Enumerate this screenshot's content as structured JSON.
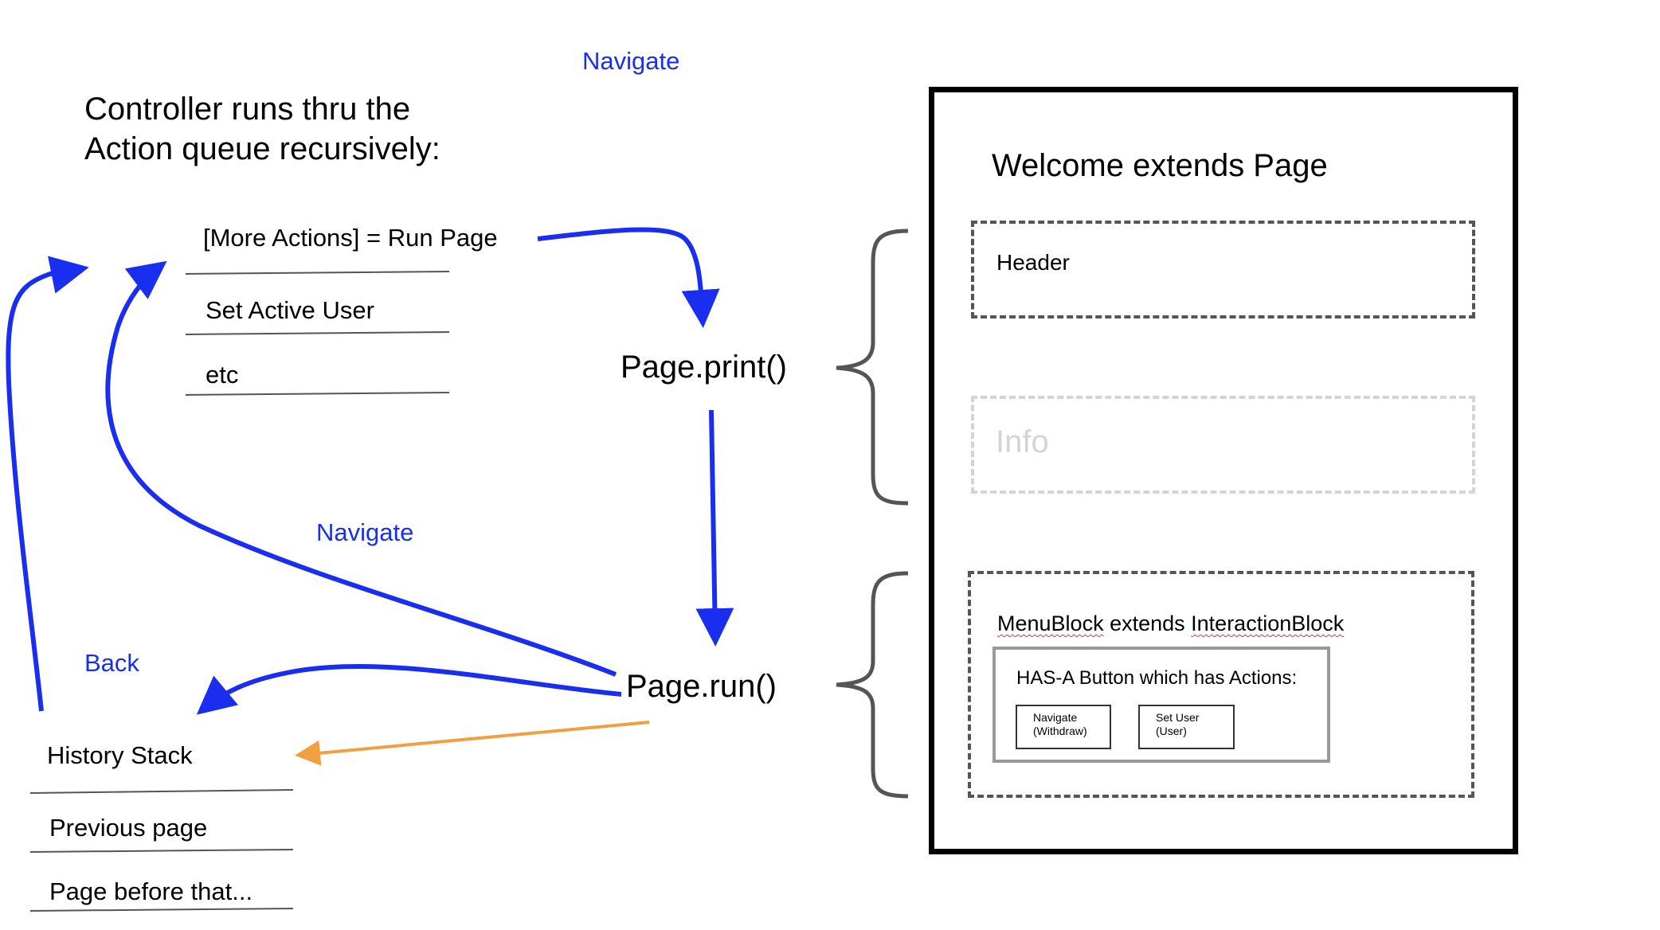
{
  "title": {
    "line1": "Controller runs thru the",
    "line2": "Action queue recursively:"
  },
  "action_queue": {
    "items": [
      "[More Actions] = Run Page",
      "Set Active User",
      "etc"
    ]
  },
  "history_stack": {
    "items": [
      "History Stack",
      "Previous page",
      "Page before that..."
    ]
  },
  "methods": {
    "print": "Page.print()",
    "run": "Page.run()"
  },
  "arrow_labels": {
    "navigate_top": "Navigate",
    "navigate_mid": "Navigate",
    "back": "Back"
  },
  "page_panel": {
    "title": "Welcome extends Page",
    "header": "Header",
    "info": "Info",
    "menu_block": {
      "prefix": "MenuBlock",
      "middle": " extends ",
      "suffix": "InteractionBlock"
    },
    "has_a": "HAS-A Button which has Actions:",
    "buttons": [
      {
        "line1": "Navigate",
        "line2": "(Withdraw)"
      },
      {
        "line1": "Set User",
        "line2": "(User)"
      }
    ]
  },
  "colors": {
    "arrow_blue": "#1a2ef0",
    "arrow_orange": "#f0a040",
    "brace_gray": "#555555",
    "dashed_gray": "#555555",
    "info_gray": "#d4d4d4"
  }
}
